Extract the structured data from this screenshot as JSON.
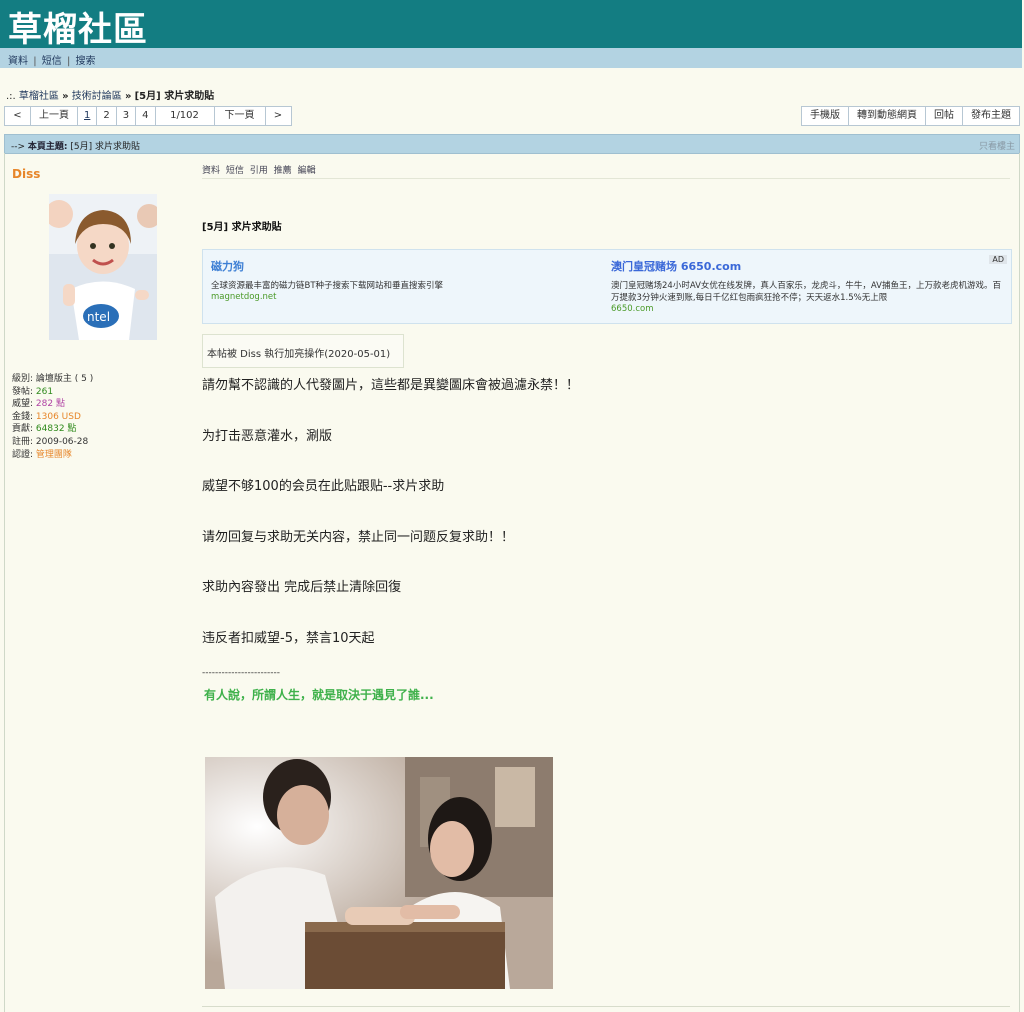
{
  "site": {
    "logo": "草榴社區"
  },
  "topnav": {
    "links": [
      "資料",
      "短信",
      "搜索"
    ],
    "sep": "|"
  },
  "breadcrumb": {
    "prefix": ".:.",
    "items": [
      "草榴社區",
      "技術討論區"
    ],
    "arrow": "»",
    "current": "[5月] 求片求助貼"
  },
  "pager": {
    "prev_symbol": "<",
    "prev_label": "上一頁",
    "pages": [
      "1",
      "2",
      "3",
      "4"
    ],
    "current_page": "1",
    "page_info": "1/102",
    "next_label": "下一頁",
    "next_symbol": ">"
  },
  "actions": {
    "mobile": "手機版",
    "dynamic": "轉到動態網頁",
    "reply": "回帖",
    "new_topic": "發布主題"
  },
  "thread": {
    "prefix": "-->",
    "label": "本頁主題:",
    "title": "[5月] 求片求助貼",
    "only_op": "只看樓主"
  },
  "author": {
    "name": "Diss",
    "avatar_icon": "portrait-girl-intel-shirt",
    "info": [
      {
        "k": "級別:",
        "v": "論壇版主 ( 5 )"
      },
      {
        "k": "發帖:",
        "v": "261"
      },
      {
        "k": "威望:",
        "v": "282 點"
      },
      {
        "k": "金錢:",
        "v": "1306 USD"
      },
      {
        "k": "貢獻:",
        "v": "64832 點"
      },
      {
        "k": "註冊:",
        "v": "2009-06-28"
      },
      {
        "k": "認證:",
        "v": "管理團隊"
      }
    ]
  },
  "post_tools": [
    "資料",
    "短信",
    "引用",
    "推薦",
    "編輯"
  ],
  "post": {
    "title": "[5月] 求片求助貼",
    "notice": "本帖被 Diss 執行加亮操作(2020-05-01)",
    "lines": [
      "請勿幫不認識的人代發圖片，這些都是異變圖床會被過濾永禁！！",
      "为打击恶意灌水，涮版",
      "威望不够100的会员在此贴跟贴--求片求助",
      "请勿回复与求助无关内容，禁止同一问题反复求助！！",
      "求助內容發出  完成后禁止清除回復",
      "违反者扣威望-5，禁言10天起"
    ],
    "sig_separator": "------------------------",
    "signature": "有人說，所謂人生，就是取決于遇見了誰..."
  },
  "ads": {
    "tag": "AD",
    "left": {
      "title": "磁力狗",
      "desc": "全球资源最丰富的磁力链BT种子搜索下载网站和垂直搜索引擎",
      "url": "magnetdog.net"
    },
    "right": {
      "title": "澳门皇冠赌场 6650.com",
      "desc": "澳门皇冠赌场24小时AV女优在线发牌，真人百家乐，龙虎斗，牛牛，AV捕鱼王，上万款老虎机游戏。百万提款3分钟火速到账,每日千亿红包雨疯狂抢不停；天天返水1.5%无上限",
      "url": "6650.com"
    }
  },
  "colors": {
    "header": "#137d82",
    "nav": "#b3d3e2",
    "bg": "#fafaef",
    "accent_orange": "#e7862a",
    "sig_green": "#3fb14b"
  }
}
